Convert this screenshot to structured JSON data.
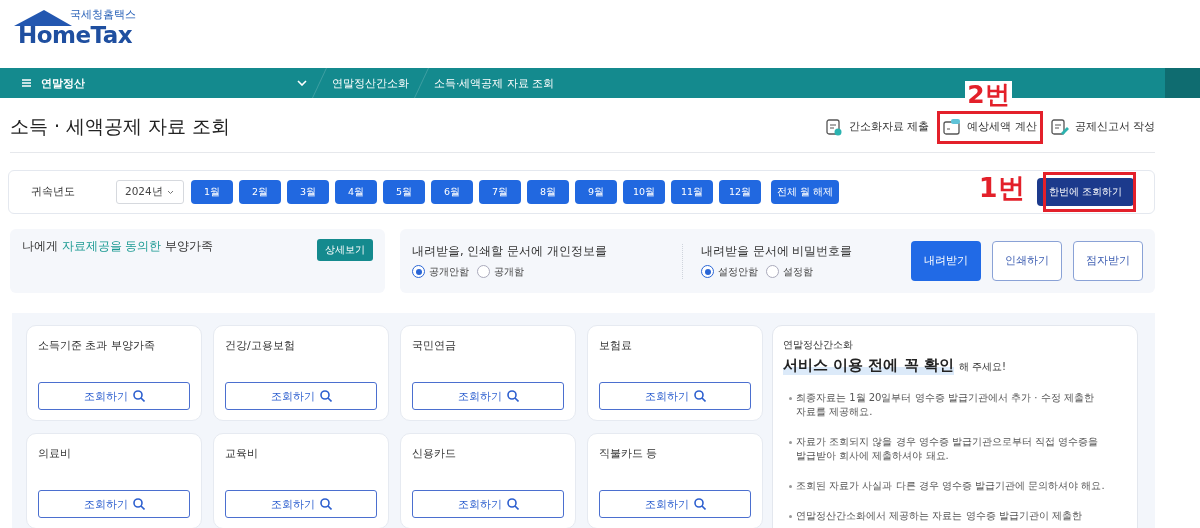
{
  "logo": {
    "subtitle": "국세청홈택스",
    "name": "HomeTax"
  },
  "nav": {
    "section": "연말정산",
    "breadcrumbs": [
      "연말정산간소화",
      "소득·세액공제 자료 조회"
    ]
  },
  "page_title": "소득 · 세액공제 자료 조회",
  "actions": [
    {
      "label": "간소화자료 제출",
      "kind": "submit"
    },
    {
      "label": "예상세액 계산",
      "kind": "calc",
      "annotation": "2번"
    },
    {
      "label": "공제신고서 작성",
      "kind": "write"
    }
  ],
  "year_bar": {
    "label": "귀속년도",
    "year": "2024년",
    "months": [
      "1월",
      "2월",
      "3월",
      "4월",
      "5월",
      "6월",
      "7월",
      "8월",
      "9월",
      "10월",
      "11월",
      "12월"
    ],
    "clear_button": "전체 월 해제",
    "query_button": "한번에 조회하기",
    "query_annotation": "1번"
  },
  "consent": {
    "text": "나에게 **자료제공을 동의한** 부양가족",
    "detail_button": "상세보기"
  },
  "privacy": {
    "title": "내려받을, 인쇄할 문서에 개인정보를",
    "options": [
      {
        "label": "공개안함",
        "selected": true
      },
      {
        "label": "공개함",
        "selected": false
      }
    ]
  },
  "password": {
    "title": "내려받을 문서에 비밀번호를",
    "options": [
      {
        "label": "설정안함",
        "selected": true
      },
      {
        "label": "설정함",
        "selected": false
      }
    ]
  },
  "output_buttons": [
    {
      "label": "내려받기",
      "kind": "primary"
    },
    {
      "label": "인쇄하기",
      "kind": "outline"
    },
    {
      "label": "점자받기",
      "kind": "outline"
    }
  ],
  "categories": [
    {
      "title": "소득기준 초과 부양가족",
      "button": "조회하기"
    },
    {
      "title": "건강/고용보험",
      "button": "조회하기"
    },
    {
      "title": "국민연금",
      "button": "조회하기"
    },
    {
      "title": "보험료",
      "button": "조회하기"
    },
    {
      "title": "의료비",
      "button": "조회하기"
    },
    {
      "title": "교육비",
      "button": "조회하기"
    },
    {
      "title": "신용카드",
      "button": "조회하기"
    },
    {
      "title": "직불카드 등",
      "button": "조회하기"
    }
  ],
  "notice": {
    "eyebrow": "연말정산간소화",
    "headline": "서비스 이용 전에 꼭 확인",
    "headline_suffix": "해 주세요!",
    "bullets": [
      "최종자료는 1월 20일부터 영수증 발급기관에서 추가 · 수정 제출한 자료를 제공해요.",
      "자료가 조회되지 않을 경우 영수증 발급기관으로부터 직접 영수증을 발급받아 회사에 제출하셔야 돼요.",
      "조회된 자료가 사실과 다른 경우 영수증 발급기관에 문의하셔야 해요.",
      "연말정산간소화에서 제공하는 자료는 영수증 발급기관이 제출한"
    ]
  }
}
